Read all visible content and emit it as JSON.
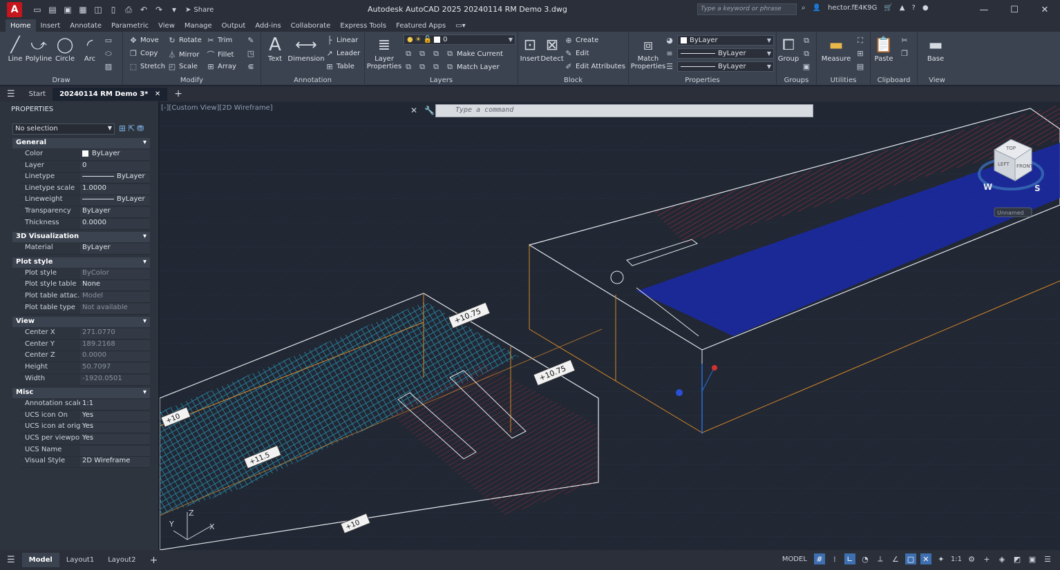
{
  "window": {
    "title": "Autodesk AutoCAD 2025    20240114 RM Demo 3.dwg",
    "search_placeholder": "Type a keyword or phrase",
    "user": "hector.fE4K9G",
    "share_label": "Share",
    "logo_letter": "A"
  },
  "ribbon_tabs": [
    "Home",
    "Insert",
    "Annotate",
    "Parametric",
    "View",
    "Manage",
    "Output",
    "Add-ins",
    "Collaborate",
    "Express Tools",
    "Featured Apps"
  ],
  "ribbon": {
    "draw": {
      "label": "Draw",
      "line": "Line",
      "polyline": "Polyline",
      "circle": "Circle",
      "arc": "Arc"
    },
    "modify": {
      "label": "Modify",
      "move": "Move",
      "rotate": "Rotate",
      "trim": "Trim",
      "copy": "Copy",
      "mirror": "Mirror",
      "fillet": "Fillet",
      "stretch": "Stretch",
      "scale": "Scale",
      "array": "Array"
    },
    "annotation": {
      "label": "Annotation",
      "text": "Text",
      "dimension": "Dimension",
      "linear": "Linear",
      "leader": "Leader",
      "table": "Table"
    },
    "layers": {
      "label": "Layers",
      "layer_properties": "Layer Properties",
      "current_layer": "0",
      "make_current": "Make Current",
      "match_layer": "Match Layer"
    },
    "block": {
      "label": "Block",
      "insert": "Insert",
      "detect": "Detect",
      "create": "Create",
      "edit": "Edit",
      "edit_attributes": "Edit Attributes"
    },
    "properties": {
      "label": "Properties",
      "match_properties": "Match Properties",
      "color": "ByLayer",
      "linetype": "ByLayer",
      "lineweight": "ByLayer"
    },
    "groups": {
      "label": "Groups",
      "group": "Group"
    },
    "utilities": {
      "label": "Utilities",
      "measure": "Measure"
    },
    "clipboard": {
      "label": "Clipboard",
      "paste": "Paste"
    },
    "view": {
      "label": "View",
      "base": "Base"
    }
  },
  "doc_tabs": {
    "start": "Start",
    "active": "20240114 RM Demo 3*"
  },
  "properties_panel": {
    "title": "PROPERTIES",
    "selection": "No selection",
    "sections": {
      "general": "General",
      "viz3d": "3D Visualization",
      "plot": "Plot style",
      "view": "View",
      "misc": "Misc"
    },
    "general": [
      {
        "name": "Color",
        "value": "ByLayer"
      },
      {
        "name": "Layer",
        "value": "0"
      },
      {
        "name": "Linetype",
        "value": "ByLayer"
      },
      {
        "name": "Linetype scale",
        "value": "1.0000"
      },
      {
        "name": "Lineweight",
        "value": "ByLayer"
      },
      {
        "name": "Transparency",
        "value": "ByLayer"
      },
      {
        "name": "Thickness",
        "value": "0.0000"
      }
    ],
    "viz3d": [
      {
        "name": "Material",
        "value": "ByLayer"
      }
    ],
    "plot": [
      {
        "name": "Plot style",
        "value": "ByColor"
      },
      {
        "name": "Plot style table",
        "value": "None"
      },
      {
        "name": "Plot table attac...",
        "value": "Model"
      },
      {
        "name": "Plot table type",
        "value": "Not available"
      }
    ],
    "view": [
      {
        "name": "Center X",
        "value": "271.0770"
      },
      {
        "name": "Center Y",
        "value": "189.2168"
      },
      {
        "name": "Center Z",
        "value": "0.0000"
      },
      {
        "name": "Height",
        "value": "50.7097"
      },
      {
        "name": "Width",
        "value": "-1920.0501"
      }
    ],
    "misc": [
      {
        "name": "Annotation scale",
        "value": "1:1"
      },
      {
        "name": "UCS icon On",
        "value": "Yes"
      },
      {
        "name": "UCS icon at orig...",
        "value": "Yes"
      },
      {
        "name": "UCS per viewport",
        "value": "Yes"
      },
      {
        "name": "UCS Name",
        "value": ""
      },
      {
        "name": "Visual Style",
        "value": "2D Wireframe"
      }
    ]
  },
  "viewport": {
    "label": "[-][Custom View][2D Wireframe]",
    "command_placeholder": "Type a command",
    "elevations": [
      "+10.75",
      "+10.75",
      "+10",
      "+11.5",
      "+10"
    ],
    "viewcube": {
      "top": "TOP",
      "left": "LEFT",
      "front": "FRONT",
      "unnamed": "Unnamed",
      "west": "W",
      "south": "S"
    }
  },
  "layout_tabs": [
    "Model",
    "Layout1",
    "Layout2"
  ],
  "status": {
    "model": "MODEL",
    "scale": "1:1"
  },
  "colors": {
    "accent": "#3e6fb0",
    "red_lines": "#e03a3a",
    "blue_fill": "#1a2aa8",
    "cyan_lines": "#2a8fb0",
    "orange_lines": "#d98a2a"
  }
}
